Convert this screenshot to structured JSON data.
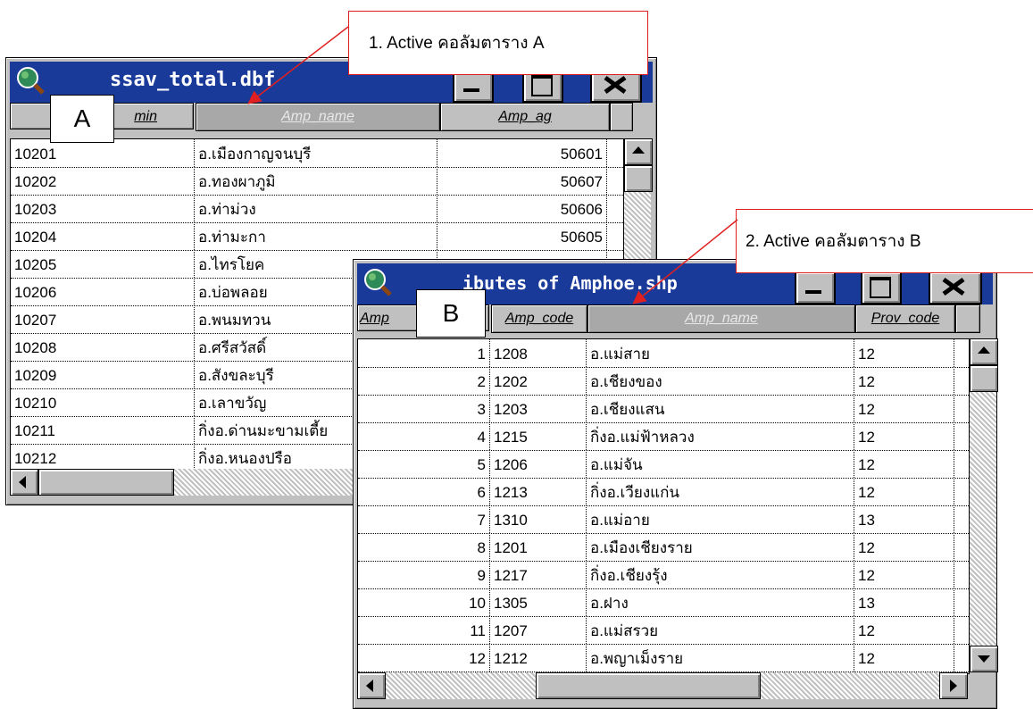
{
  "callouts": {
    "a_text": "1. Active คอลัมตาราง A",
    "b_text": "2. Active คอลัมตาราง B"
  },
  "labels": {
    "a": "A",
    "b": "B"
  },
  "window_a": {
    "title": "ssav_total.dbf",
    "columns": [
      "min",
      "Amp_name",
      "Amp_ag"
    ],
    "rows": [
      [
        "10201",
        "อ.เมืองกาญจนบุรี",
        "50601"
      ],
      [
        "10202",
        "อ.ทองผาภูมิ",
        "50607"
      ],
      [
        "10203",
        "อ.ท่าม่วง",
        "50606"
      ],
      [
        "10204",
        "อ.ท่ามะกา",
        "50605"
      ],
      [
        "10205",
        "อ.ไทรโยค",
        ""
      ],
      [
        "10206",
        "อ.บ่อพลอย",
        ""
      ],
      [
        "10207",
        "อ.พนมทวน",
        ""
      ],
      [
        "10208",
        "อ.ศรีสวัสดิ์",
        ""
      ],
      [
        "10209",
        "อ.สังขละบุรี",
        ""
      ],
      [
        "10210",
        "อ.เลาขวัญ",
        ""
      ],
      [
        "10211",
        "กิ่งอ.ด่านมะขามเตี้ย",
        ""
      ],
      [
        "10212",
        "กิ่งอ.หนองปรือ",
        ""
      ]
    ]
  },
  "window_b": {
    "title": "ibutes of Amphoe.shp",
    "columns": [
      "Amp",
      "Amp_code",
      "Amp_name",
      "Prov_code"
    ],
    "rows": [
      [
        "1",
        "1208",
        "อ.แม่สาย",
        "12"
      ],
      [
        "2",
        "1202",
        "อ.เชียงของ",
        "12"
      ],
      [
        "3",
        "1203",
        "อ.เชียงแสน",
        "12"
      ],
      [
        "4",
        "1215",
        "กิ่งอ.แม่ฟ้าหลวง",
        "12"
      ],
      [
        "5",
        "1206",
        "อ.แม่จัน",
        "12"
      ],
      [
        "6",
        "1213",
        "กิ่งอ.เวียงแก่น",
        "12"
      ],
      [
        "7",
        "1310",
        "อ.แม่อาย",
        "13"
      ],
      [
        "8",
        "1201",
        "อ.เมืองเชียงราย",
        "12"
      ],
      [
        "9",
        "1217",
        "กิ่งอ.เชียงรุ้ง",
        "12"
      ],
      [
        "10",
        "1305",
        "อ.ฝาง",
        "13"
      ],
      [
        "11",
        "1207",
        "อ.แม่สรวย",
        "12"
      ],
      [
        "12",
        "1212",
        "อ.พญาเม็งราย",
        "12"
      ]
    ]
  },
  "colors": {
    "titlebar": "#1a3a9a",
    "callout_border": "#e02020",
    "active_column": "#a8a8a8"
  }
}
